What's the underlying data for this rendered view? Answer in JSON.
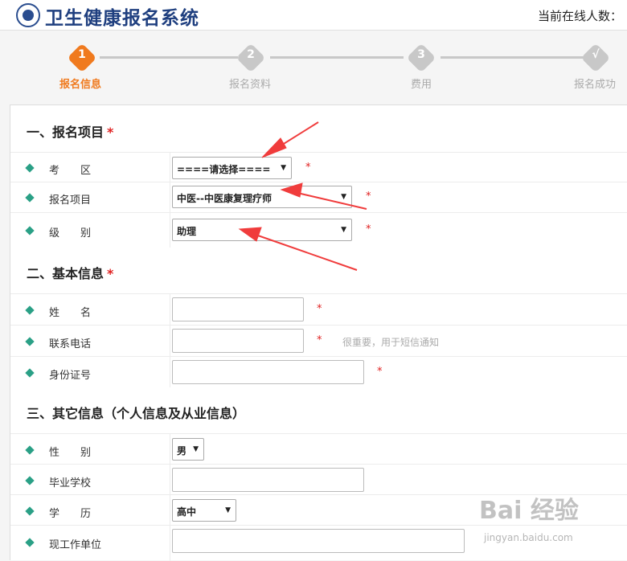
{
  "header": {
    "title": "卫生健康报名系统",
    "online_label": "当前在线人数："
  },
  "steps": [
    {
      "num": "1",
      "label": "报名信息",
      "active": true
    },
    {
      "num": "2",
      "label": "报名资料",
      "active": false
    },
    {
      "num": "3",
      "label": "费用",
      "active": false
    },
    {
      "num": "√",
      "label": "报名成功",
      "active": false
    }
  ],
  "sections": {
    "s1": "一、报名项目",
    "s2": "二、基本信息",
    "s3": "三、其它信息（个人信息及从业信息）",
    "required_mark": "*"
  },
  "form": {
    "exam_area": {
      "label": "考　　区",
      "value": "====请选择===="
    },
    "project": {
      "label": "报名项目",
      "value": "中医--中医康复理疗师"
    },
    "level": {
      "label": "级　　别",
      "value": "助理"
    },
    "name": {
      "label": "姓　　名",
      "value": ""
    },
    "phone": {
      "label": "联系电话",
      "value": "",
      "hint": "很重要，用于短信通知"
    },
    "id_card": {
      "label": "身份证号",
      "value": ""
    },
    "gender": {
      "label": "性　　别",
      "value": "男"
    },
    "school": {
      "label": "毕业学校",
      "value": ""
    },
    "education": {
      "label": "学　　历",
      "value": "高中"
    },
    "employer": {
      "label": "现工作单位",
      "value": ""
    }
  },
  "watermark": {
    "brand": "Bai 经验",
    "url": "jingyan.baidu.com"
  },
  "colors": {
    "accent": "#f07a1e",
    "diamond": "#2aa086",
    "required": "#e02020",
    "arrow": "#f03c3c"
  }
}
